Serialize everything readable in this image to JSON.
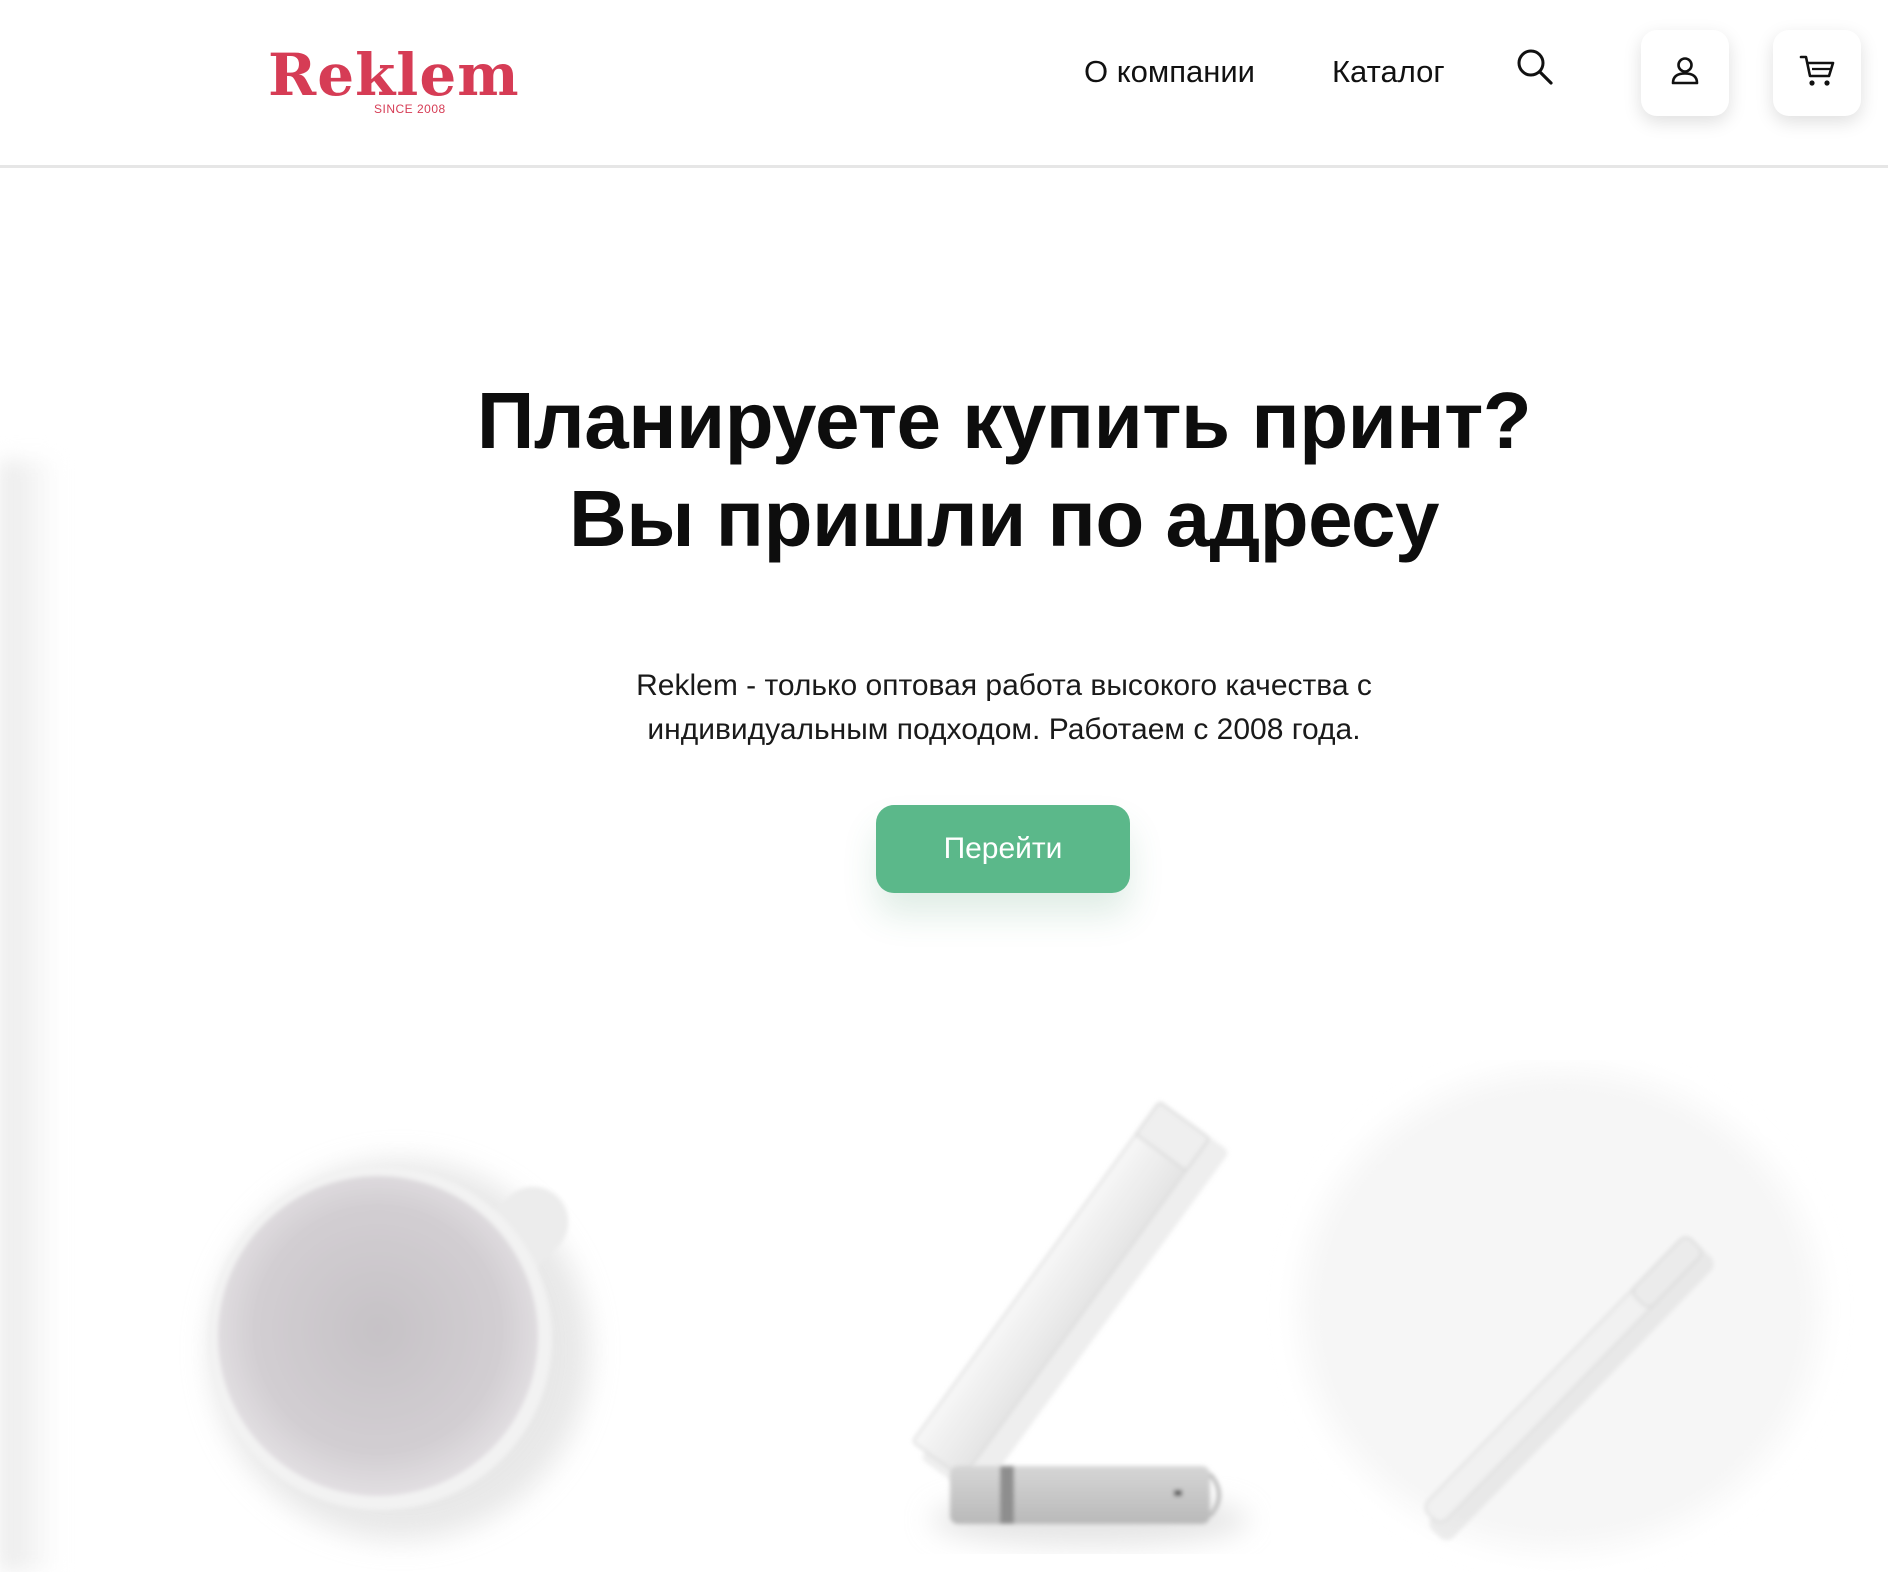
{
  "header": {
    "logo": {
      "name": "Reklem",
      "tagline": "SINCE 2008"
    },
    "nav": {
      "about": "О компании",
      "catalog": "Каталог"
    },
    "icons": {
      "search": "search-icon",
      "account": "user-icon",
      "cart": "cart-icon"
    }
  },
  "hero": {
    "title_line1": "Планируете купить принт?",
    "title_line2": "Вы пришли по адресу",
    "description": "Reklem - только оптовая работа высокого качества с индивидуальным подходом. Работаем с 2008 года.",
    "cta_label": "Перейти"
  },
  "colors": {
    "brand_red": "#d63c55",
    "cta_green": "#5bb88a",
    "text": "#111111"
  }
}
